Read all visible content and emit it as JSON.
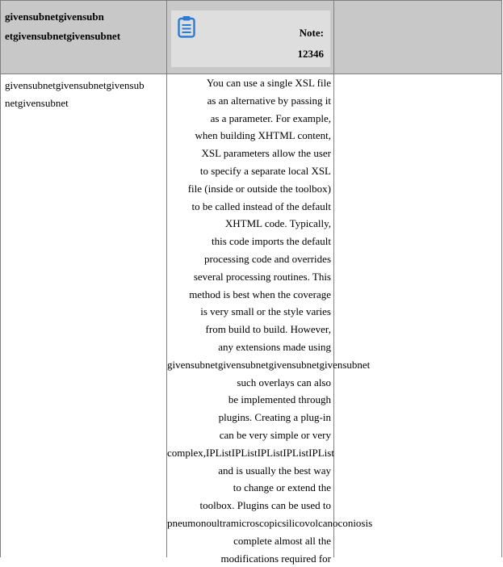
{
  "header": {
    "col1_lines": [
      "givensubnetgivensubn",
      "etgivensubnetgivensubnet"
    ],
    "note_label": "Note:",
    "note_number": "12346",
    "note_icon": "clipboard-icon"
  },
  "row": {
    "col1_lines": [
      "givensubnetgivensubnetgivensub",
      "netgivensubnet"
    ],
    "col2_lines": [
      "You can use a single XSL file",
      "as an alternative by passing it",
      "as a parameter. For example,",
      "when building XHTML content,",
      "XSL parameters allow the user",
      "to specify a separate local XSL",
      "file (inside or outside the toolbox)",
      "to be called instead of the default",
      "XHTML code. Typically,",
      "this code imports the default",
      "processing code and overrides",
      "several processing routines. This",
      "method is best when the coverage",
      "is very small or the style varies",
      "from build to build. However,",
      "any extensions made using",
      "givensubnetgivensubnetgivensubnetgivensubnet",
      "such overlays can also",
      "be implemented through",
      "plugins. Creating a plug-in",
      "can be very simple or very",
      "complex,IPListIPListIPListIPListIPList",
      "and is usually the best way",
      "to change or extend the",
      "toolbox. Plugins can be used to",
      "pneumonoultramicroscopicsilicovolcanoconiosis",
      "complete almost all the",
      "modifications required for"
    ]
  },
  "colors": {
    "header_bg": "#c8c8c8",
    "note_bg": "#dedede",
    "icon": "#2b7bd6",
    "border": "#7f7f7f"
  }
}
